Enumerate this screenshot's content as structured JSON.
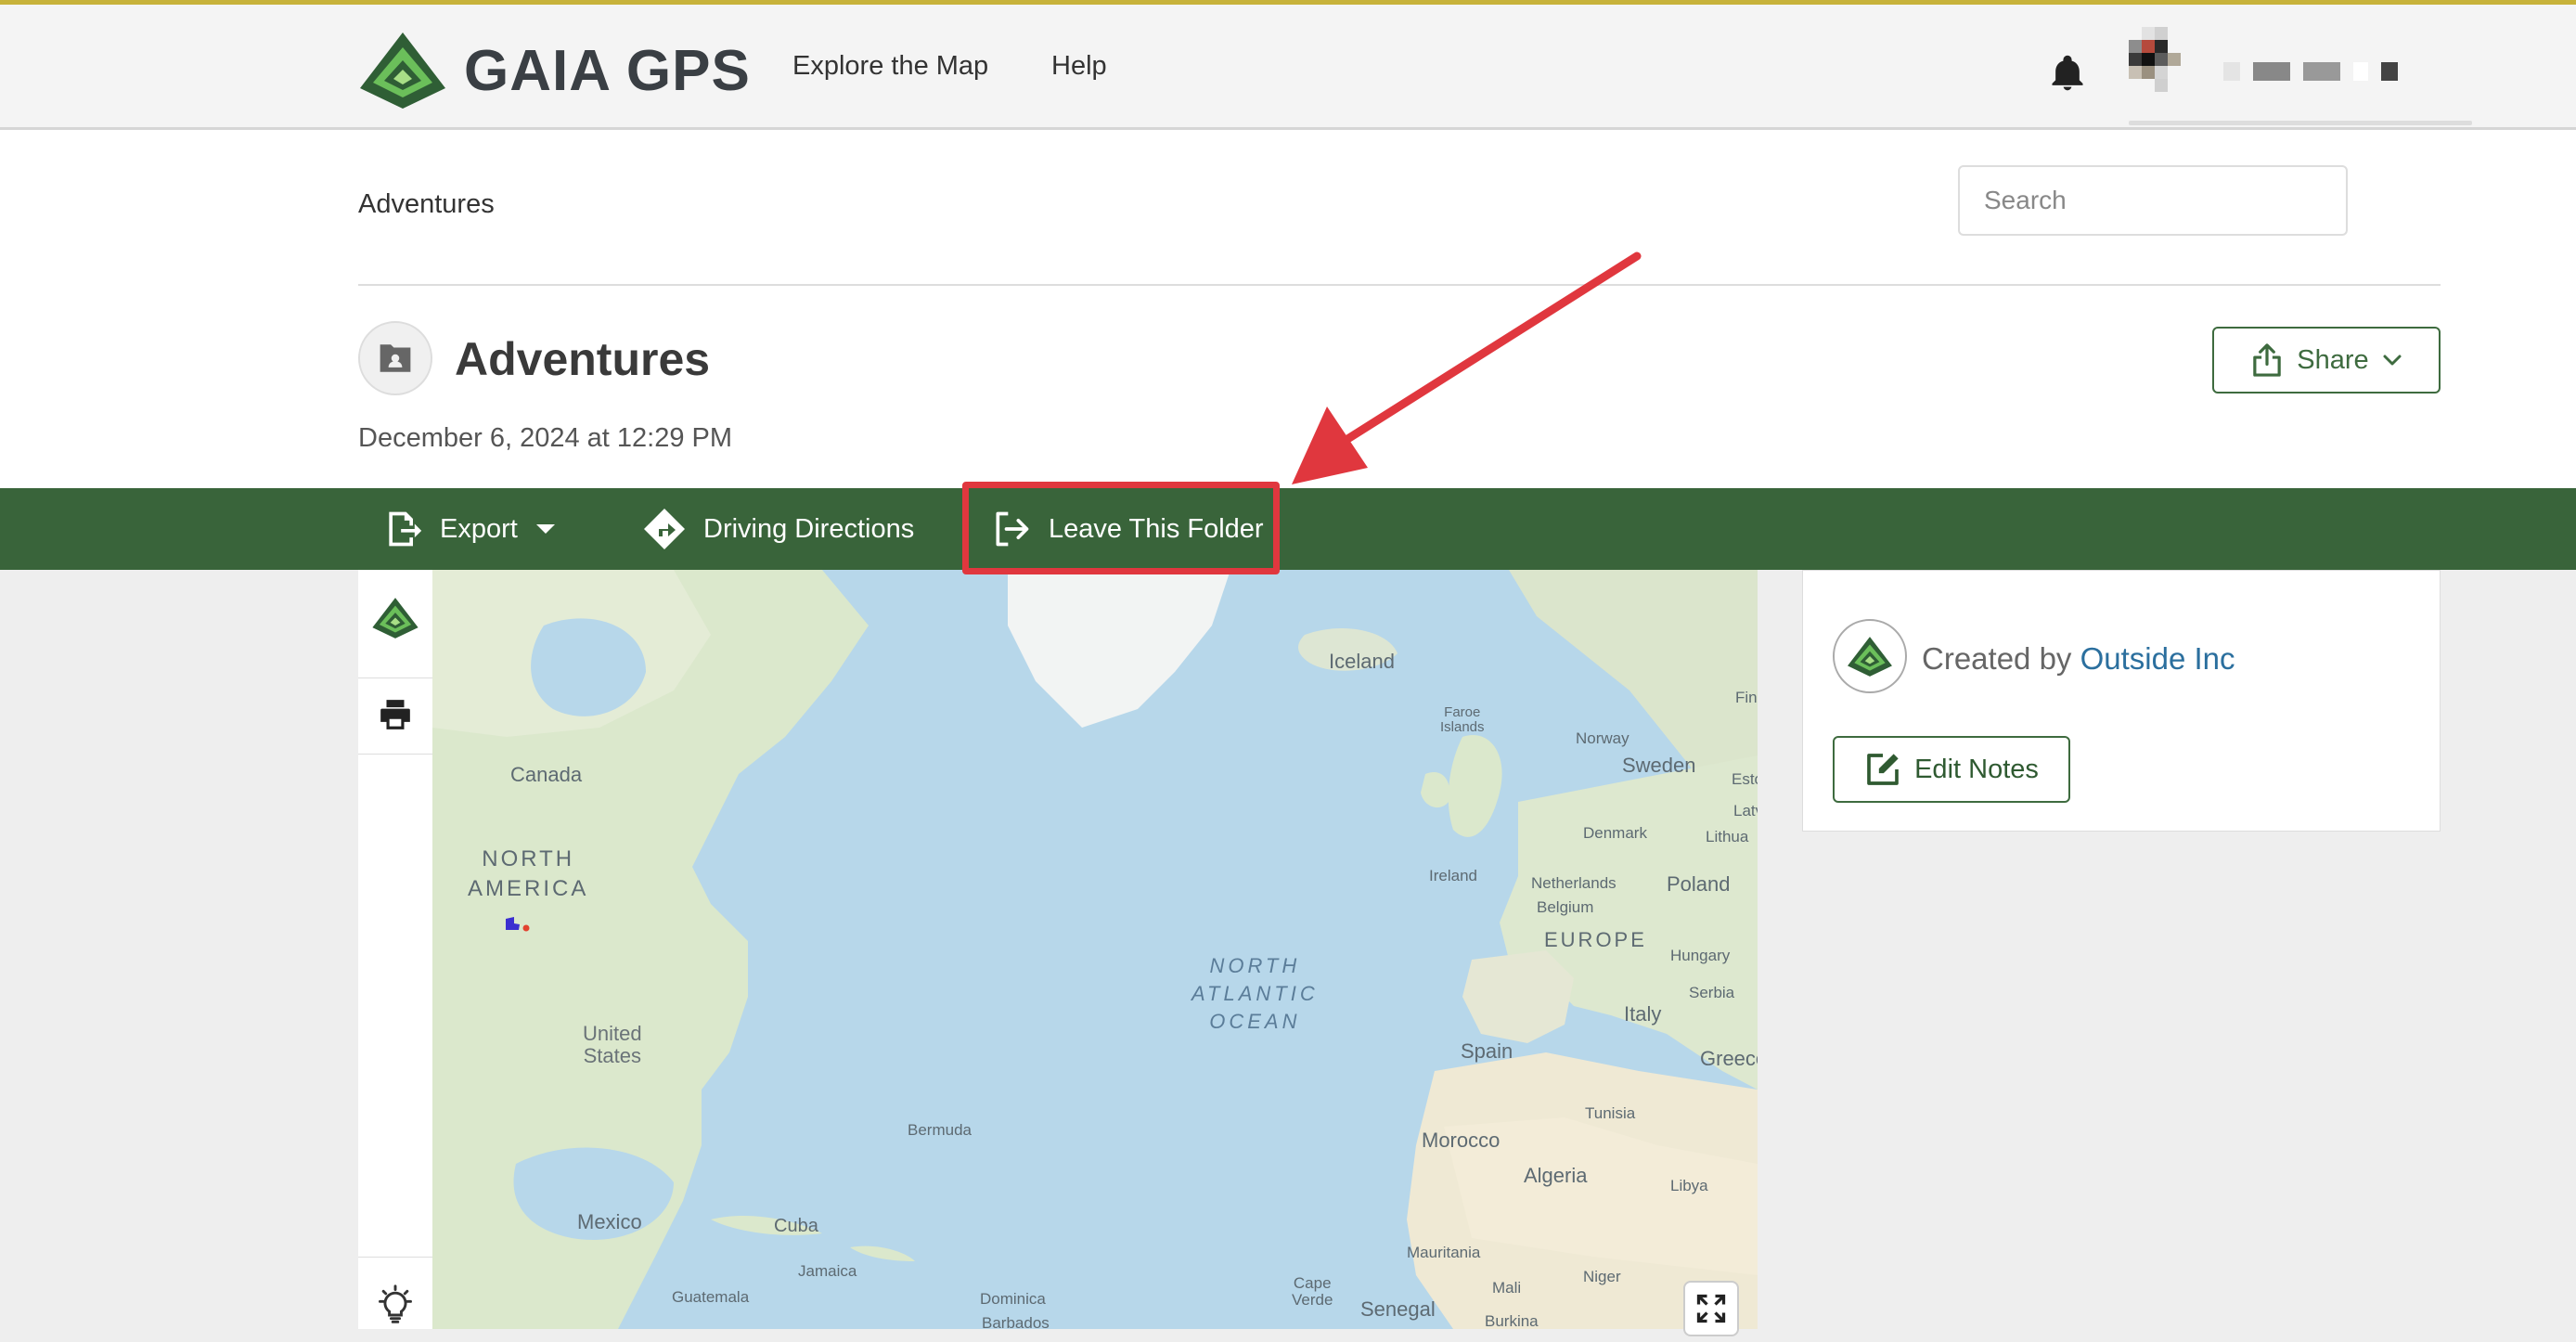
{
  "header": {
    "brand": "GAIA GPS",
    "nav": [
      {
        "label": "Explore the Map"
      },
      {
        "label": "Help"
      }
    ]
  },
  "breadcrumb": "Adventures",
  "search": {
    "placeholder": "Search"
  },
  "folder": {
    "title": "Adventures",
    "date": "December 6, 2024 at 12:29 PM",
    "share_label": "Share"
  },
  "toolbar": {
    "export_label": "Export",
    "driving_label": "Driving Directions",
    "leave_label": "Leave This Folder"
  },
  "map": {
    "labels": {
      "canada": "Canada",
      "north_america": "NORTH\nAMERICA",
      "united_states": "United\nStates",
      "mexico": "Mexico",
      "cuba": "Cuba",
      "jamaica": "Jamaica",
      "guatemala": "Guatemala",
      "bermuda": "Bermuda",
      "dominica": "Dominica",
      "barbados": "Barbados",
      "cape_verde": "Cape\nVerde",
      "senegal": "Senegal",
      "iceland": "Iceland",
      "faroe": "Faroe\nIslands",
      "norway": "Norway",
      "sweden": "Sweden",
      "finland": "Fin",
      "estonia": "Esto",
      "latvia": "Latv",
      "lithuania": "Lithua",
      "denmark": "Denmark",
      "ireland": "Ireland",
      "netherlands": "Netherlands",
      "belgium": "Belgium",
      "poland": "Poland",
      "europe": "EUROPE",
      "hungary": "Hungary",
      "serbia": "Serbia",
      "italy": "Italy",
      "greece": "Greece",
      "spain": "Spain",
      "tunisia": "Tunisia",
      "morocco": "Morocco",
      "algeria": "Algeria",
      "libya": "Libya",
      "mauritania": "Mauritania",
      "mali": "Mali",
      "niger": "Niger",
      "burkina": "Burkina",
      "ocean": "NORTH\nATLANTIC\nOCEAN"
    }
  },
  "sidebar": {
    "created_by_prefix": "Created by ",
    "creator_name": "Outside Inc",
    "edit_notes_label": "Edit Notes"
  },
  "colors": {
    "toolbar_green": "#39643a",
    "accent_green": "#3e6b3f",
    "highlight_red": "#e0373e",
    "link_blue": "#2b6f9e"
  }
}
